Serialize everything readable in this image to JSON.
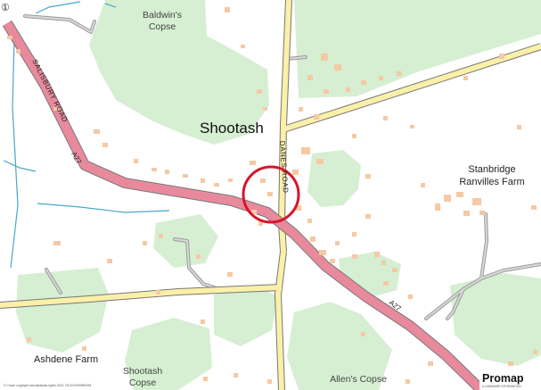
{
  "map": {
    "places": {
      "shootash": "Shootash",
      "baldwins_copse_1": "Baldwin's",
      "baldwins_copse_2": "Copse",
      "stanbridge_1": "Stanbridge",
      "stanbridge_2": "Ranvilles Farm",
      "ashdene_farm": "Ashdene Farm",
      "shootash_copse_1": "Shootash",
      "shootash_copse_2": "Copse",
      "allens_copse": "Allen's Copse"
    },
    "roads": {
      "salisbury_road": "SALISBURY ROAD",
      "danes_road": "DANES ROAD",
      "a27_west": "A27",
      "a27_east": "A27"
    },
    "north_symbol": "①",
    "copyright": "© Crown copyright and database rights 2024. OS AC0000851063",
    "brand": {
      "name": "Promap",
      "tagline": "A LANDMARK INFORMATION"
    },
    "colors": {
      "woodland": "#d6efd2",
      "a_road": "#e88a9c",
      "minor_road": "#fbf0a8",
      "track": "#b8b8b8",
      "water": "#4aa6c9",
      "building": "#f5c9a4",
      "marker": "#d8142a"
    }
  }
}
